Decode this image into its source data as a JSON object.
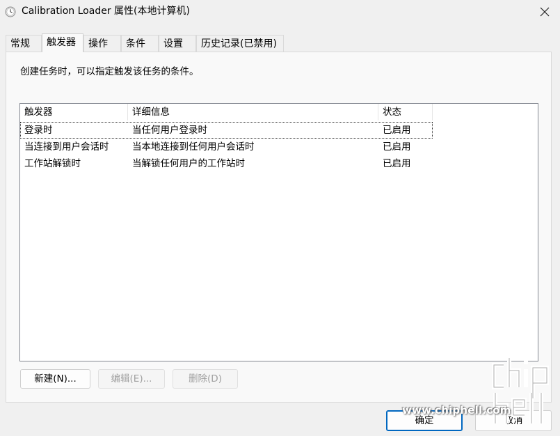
{
  "window": {
    "title": "Calibration Loader 属性(本地计算机)",
    "icon": "clock-icon"
  },
  "tabs": [
    {
      "label": "常规"
    },
    {
      "label": "触发器",
      "active": true
    },
    {
      "label": "操作"
    },
    {
      "label": "条件"
    },
    {
      "label": "设置"
    },
    {
      "label": "历史记录(已禁用)"
    }
  ],
  "panel": {
    "description": "创建任务时，可以指定触发该任务的条件。"
  },
  "list": {
    "columns": [
      "触发器",
      "详细信息",
      "状态"
    ],
    "rows": [
      [
        "登录时",
        "当任何用户登录时",
        "已启用"
      ],
      [
        "当连接到用户会话时",
        "当本地连接到任何用户会话时",
        "已启用"
      ],
      [
        "工作站解锁时",
        "当解锁任何用户的工作站时",
        "已启用"
      ]
    ]
  },
  "buttons": {
    "new": "新建(N)...",
    "edit": "编辑(E)...",
    "delete": "删除(D)",
    "ok": "确定",
    "cancel": "取消"
  },
  "watermark": {
    "url": "www.chiphell.com"
  },
  "colors": {
    "accent": "#0067c0",
    "window_bg": "#f0f0f0",
    "panel_bg": "#f9f9f9"
  }
}
